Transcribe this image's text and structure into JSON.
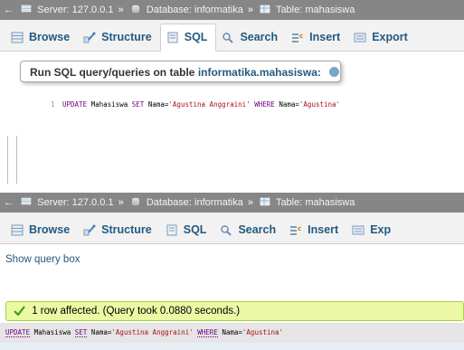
{
  "breadcrumb": {
    "back": "←",
    "server_label": "Server: 127.0.0.1",
    "sep1": "»",
    "database_label": "Database: informatika",
    "sep2": "»",
    "table_label": "Table: mahasiswa"
  },
  "tabs": [
    {
      "label": "Browse",
      "icon": "browse-icon"
    },
    {
      "label": "Structure",
      "icon": "structure-icon"
    },
    {
      "label": "SQL",
      "icon": "sql-icon"
    },
    {
      "label": "Search",
      "icon": "search-icon"
    },
    {
      "label": "Insert",
      "icon": "insert-icon"
    },
    {
      "label": "Export",
      "icon": "export-icon"
    }
  ],
  "tabs_panel2": [
    {
      "label": "Browse"
    },
    {
      "label": "Structure"
    },
    {
      "label": "SQL"
    },
    {
      "label": "Search"
    },
    {
      "label": "Insert"
    },
    {
      "label": "Exp"
    }
  ],
  "query_panel": {
    "legend_prefix": "Run SQL query/queries on table ",
    "legend_table": "informatika.mahasiswa:",
    "line_number": "1",
    "sql": {
      "update": "UPDATE",
      "table": " Mahasiswa ",
      "set": "SET",
      "assign": " Nama=",
      "value": "'Agustina Anggraini'",
      "space": " ",
      "where": "WHERE",
      "cond": " Nama=",
      "cond_value": "'Agustina'"
    }
  },
  "result_panel": {
    "show_query_box": "Show query box",
    "success_message": "1 row affected. (Query took 0.0880 seconds.)",
    "sql": {
      "update": "UPDATE",
      "table": " Mahasiswa ",
      "set": "SET",
      "assign": " Nama=",
      "value": "'Agustina Anggraini'",
      "space": " ",
      "where": "WHERE",
      "cond": " Nama=",
      "cond_value": "'Agustina'"
    }
  },
  "colors": {
    "breadcrumb_bg": "#868686",
    "tab_text": "#235a81",
    "success_bg": "#ebf8a4",
    "success_border": "#a2d246"
  }
}
